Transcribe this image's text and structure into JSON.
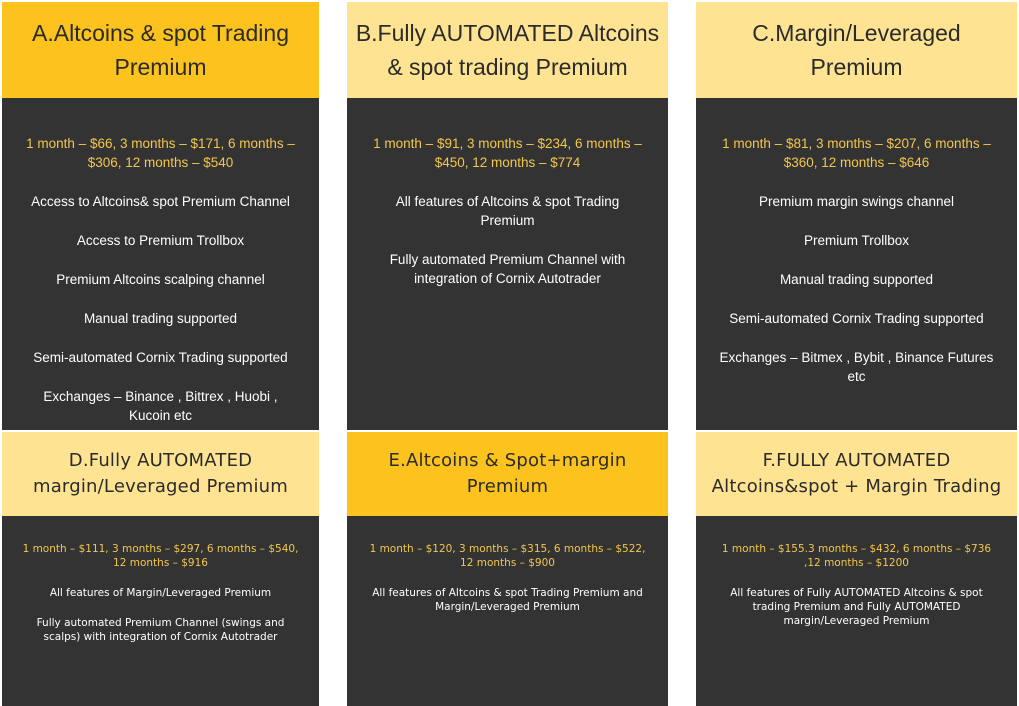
{
  "colors": {
    "header_strong": "#fcc21e",
    "header_light": "#fde392",
    "card_body": "#333333",
    "price_text": "#f3c64e",
    "feature_text": "#ffffff"
  },
  "plans": [
    {
      "title": "A.Altcoins & spot Trading Premium",
      "price": "1 month – $66, 3 months – $171, 6 months – $306, 12 months – $540",
      "features": [
        "Access to Altcoins& spot Premium Channel",
        "Access to Premium Trollbox",
        "Premium Altcoins scalping channel",
        "Manual trading supported",
        "Semi-automated Cornix Trading supported",
        "Exchanges – Binance , Bittrex , Huobi , Kucoin etc"
      ]
    },
    {
      "title": "B.Fully AUTOMATED Altcoins & spot trading Premium",
      "price": "1 month – $91, 3 months – $234, 6 months – $450, 12 months – $774",
      "features": [
        "All features of Altcoins & spot Trading Premium",
        "Fully automated Premium Channel with integration of Cornix Autotrader"
      ]
    },
    {
      "title": "C.Margin/Leveraged Premium",
      "price": "1 month – $81, 3 months – $207, 6 months – $360, 12 months – $646",
      "features": [
        "Premium margin swings channel",
        "Premium Trollbox",
        "Manual trading supported",
        "Semi-automated Cornix Trading supported",
        "Exchanges – Bitmex , Bybit , Binance Futures etc"
      ]
    },
    {
      "title": "D.Fully AUTOMATED margin/Leveraged Premium",
      "price": "1 month – $111, 3 months – $297, 6 months – $540, 12 months – $916",
      "features": [
        "All features of Margin/Leveraged Premium",
        "Fully automated Premium Channel (swings and scalps) with integration of Cornix Autotrader"
      ]
    },
    {
      "title": "E.Altcoins & Spot+margin Premium",
      "price": "1 month – $120, 3 months – $315, 6 months – $522, 12 months – $900",
      "features": [
        "All features of Altcoins & spot Trading Premium and Margin/Leveraged Premium"
      ]
    },
    {
      "title": "F.FULLY AUTOMATED Altcoins&spot + Margin Trading",
      "price": "1 month – $155.3 months – $432, 6 months – $736 ,12 months – $1200",
      "features": [
        "All features of Fully AUTOMATED Altcoins & spot trading Premium and Fully AUTOMATED margin/Leveraged Premium"
      ]
    }
  ]
}
